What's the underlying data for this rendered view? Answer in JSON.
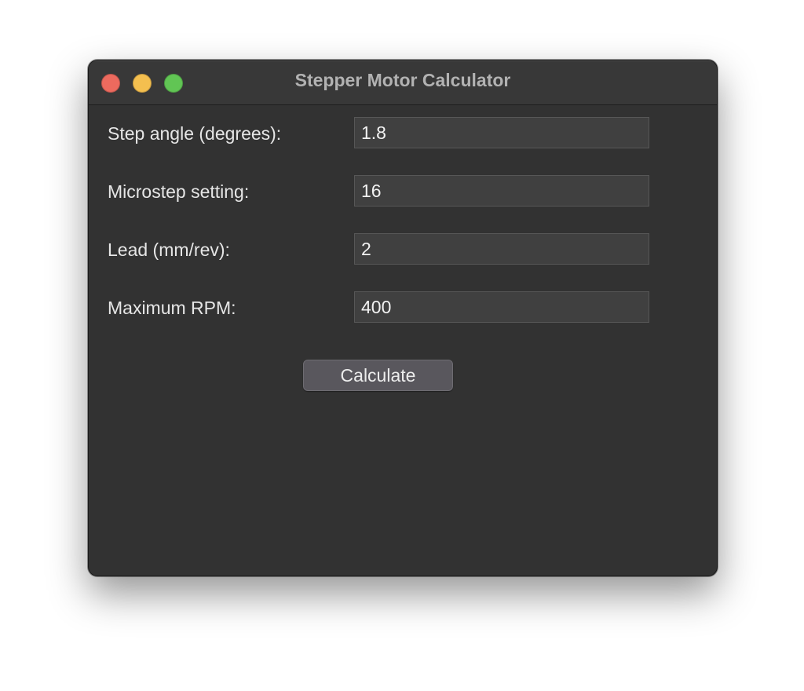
{
  "window": {
    "title": "Stepper Motor Calculator",
    "traffic_lights": {
      "close": {
        "icon": "close-icon",
        "color": "#ec6a5e"
      },
      "minimize": {
        "icon": "minimize-icon",
        "color": "#f4bf4f"
      },
      "maximize": {
        "icon": "maximize-icon",
        "color": "#61c554"
      }
    }
  },
  "form": {
    "fields": [
      {
        "label": "Step angle (degrees):",
        "value": "1.8"
      },
      {
        "label": "Microstep setting:",
        "value": "16"
      },
      {
        "label": "Lead (mm/rev):",
        "value": "2"
      },
      {
        "label": "Maximum RPM:",
        "value": "400"
      }
    ],
    "calculate_label": "Calculate"
  },
  "colors": {
    "window_bg": "#323232",
    "field_bg": "#404040",
    "button_bg": "#59575d"
  }
}
